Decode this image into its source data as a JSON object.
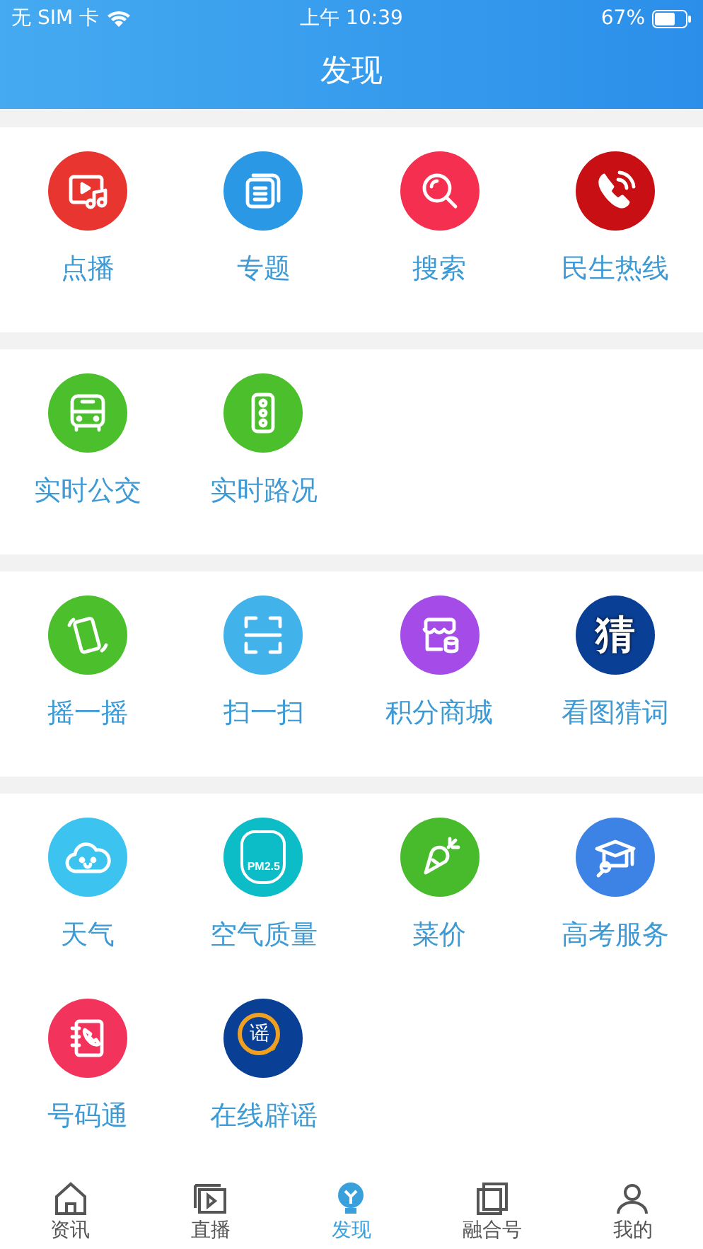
{
  "status_bar": {
    "carrier": "无 SIM 卡",
    "time": "上午 10:39",
    "battery": "67%"
  },
  "header": {
    "title": "发现"
  },
  "sections": [
    {
      "items": [
        {
          "label": "点播",
          "kind": "video-music",
          "color": "#e8352f"
        },
        {
          "label": "专题",
          "kind": "documents",
          "color": "#2a98e4"
        },
        {
          "label": "搜索",
          "kind": "search",
          "color": "#f52f4f"
        },
        {
          "label": "民生热线",
          "kind": "phone-call",
          "color": "#c80f14"
        }
      ]
    },
    {
      "items": [
        {
          "label": "实时公交",
          "kind": "bus",
          "color": "#4cbf2c"
        },
        {
          "label": "实时路况",
          "kind": "traffic-light",
          "color": "#4cbf2c"
        }
      ]
    },
    {
      "items": [
        {
          "label": "摇一摇",
          "kind": "shake",
          "color": "#4cbf2c"
        },
        {
          "label": "扫一扫",
          "kind": "scan",
          "color": "#41b3ea"
        },
        {
          "label": "积分商城",
          "kind": "shop",
          "color": "#a54be8"
        },
        {
          "label": "看图猜词",
          "kind": "glyph",
          "glyph": "猜",
          "color": "#0a3f96"
        }
      ]
    },
    {
      "items": [
        {
          "label": "天气",
          "kind": "cloud",
          "color": "#3cc3f0"
        },
        {
          "label": "空气质量",
          "kind": "pm",
          "glyph": "PM2.5",
          "color": "#0cbcc7"
        },
        {
          "label": "菜价",
          "kind": "carrot",
          "color": "#48bb2c"
        },
        {
          "label": "高考服务",
          "kind": "cap",
          "color": "#3d83e6"
        },
        {
          "label": "号码通",
          "kind": "phonebook",
          "color": "#f2335c"
        },
        {
          "label": "在线辟谣",
          "kind": "glyph-search",
          "glyph": "谣",
          "color": "#0a3f96"
        }
      ]
    }
  ],
  "tab_bar": [
    {
      "label": "资讯",
      "kind": "home",
      "selected": false
    },
    {
      "label": "直播",
      "kind": "play",
      "selected": false
    },
    {
      "label": "发现",
      "kind": "bulb",
      "selected": true
    },
    {
      "label": "融合号",
      "kind": "layers",
      "selected": false
    },
    {
      "label": "我的",
      "kind": "person",
      "selected": false
    }
  ]
}
